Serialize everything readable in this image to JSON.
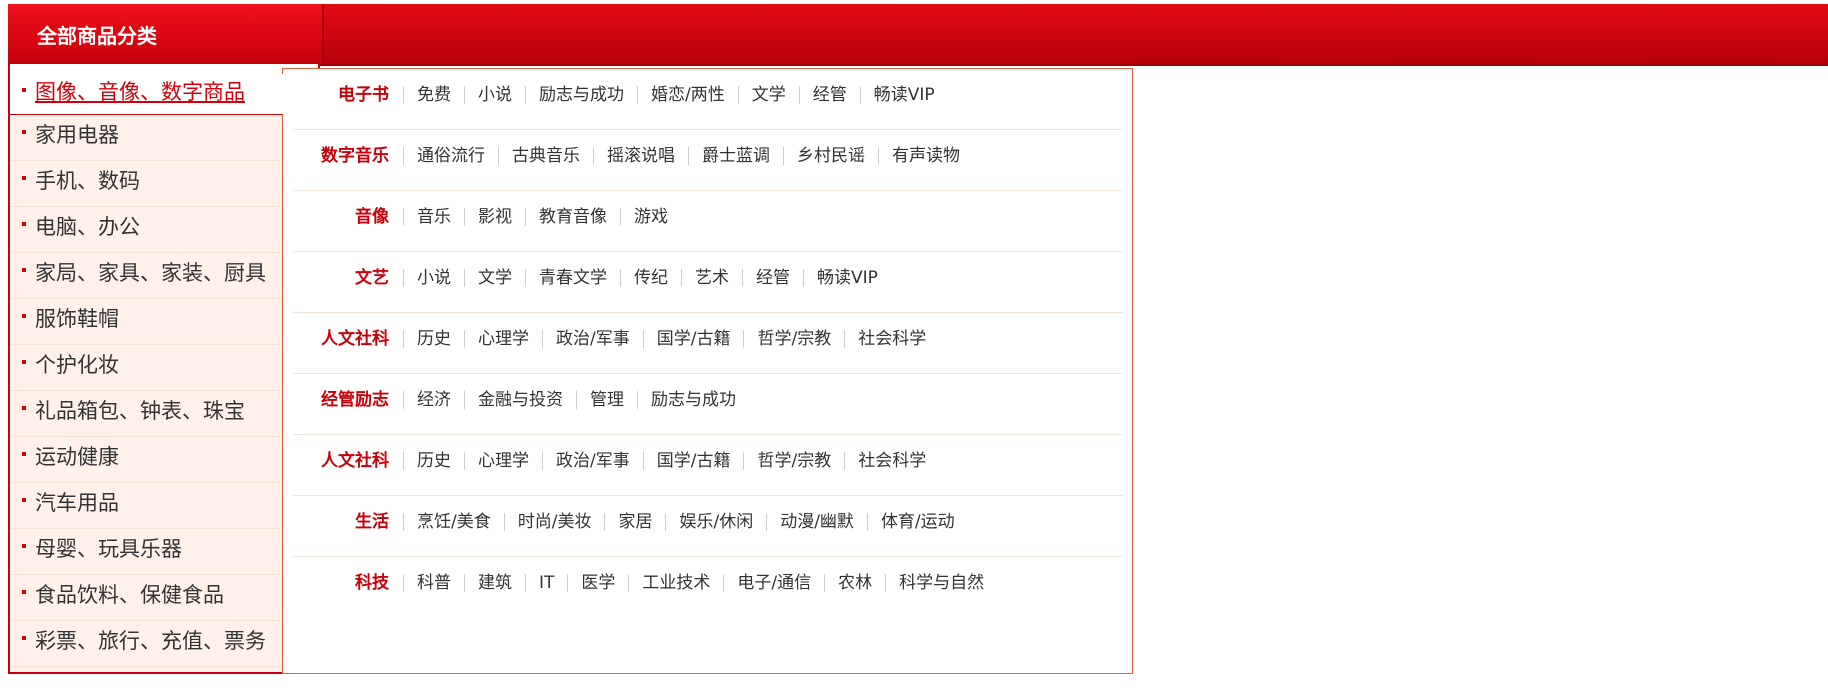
{
  "header": {
    "title": "全部商品分类"
  },
  "menu": {
    "active": "图像、音像、数字商品",
    "items": [
      "家用电器",
      "手机、数码",
      "电脑、办公",
      "家局、家具、家装、厨具",
      "服饰鞋帽",
      "个护化妆",
      "礼品箱包、钟表、珠宝",
      "运动健康",
      "汽车用品",
      "母婴、玩具乐器",
      "食品饮料、保健食品",
      "彩票、旅行、充值、票务"
    ]
  },
  "submenu": [
    {
      "title": "电子书",
      "links": [
        "免费",
        "小说",
        "励志与成功",
        "婚恋/两性",
        "文学",
        "经管",
        "畅读VIP"
      ]
    },
    {
      "title": "数字音乐",
      "links": [
        "通俗流行",
        "古典音乐",
        "摇滚说唱",
        "爵士蓝调",
        "乡村民谣",
        "有声读物"
      ]
    },
    {
      "title": "音像",
      "links": [
        "音乐",
        "影视",
        "教育音像",
        "游戏"
      ]
    },
    {
      "title": "文艺",
      "links": [
        "小说",
        "文学",
        "青春文学",
        "传纪",
        "艺术",
        "经管",
        "畅读VIP"
      ]
    },
    {
      "title": "人文社科",
      "links": [
        "历史",
        "心理学",
        "政治/军事",
        "国学/古籍",
        "哲学/宗教",
        "社会科学"
      ]
    },
    {
      "title": "经管励志",
      "links": [
        "经济",
        "金融与投资",
        "管理",
        "励志与成功"
      ]
    },
    {
      "title": "人文社科",
      "links": [
        "历史",
        "心理学",
        "政治/军事",
        "国学/古籍",
        "哲学/宗教",
        "社会科学"
      ]
    },
    {
      "title": "生活",
      "links": [
        "烹饪/美食",
        "时尚/美妆",
        "家居",
        "娱乐/休闲",
        "动漫/幽默",
        "体育/运动"
      ]
    },
    {
      "title": "科技",
      "links": [
        "科普",
        "建筑",
        "IT",
        "医学",
        "工业技术",
        "电子/通信",
        "农林",
        "科学与自然"
      ]
    }
  ],
  "colors": {
    "brand_red": "#d0000d",
    "menu_bg": "#fdf1e9"
  }
}
